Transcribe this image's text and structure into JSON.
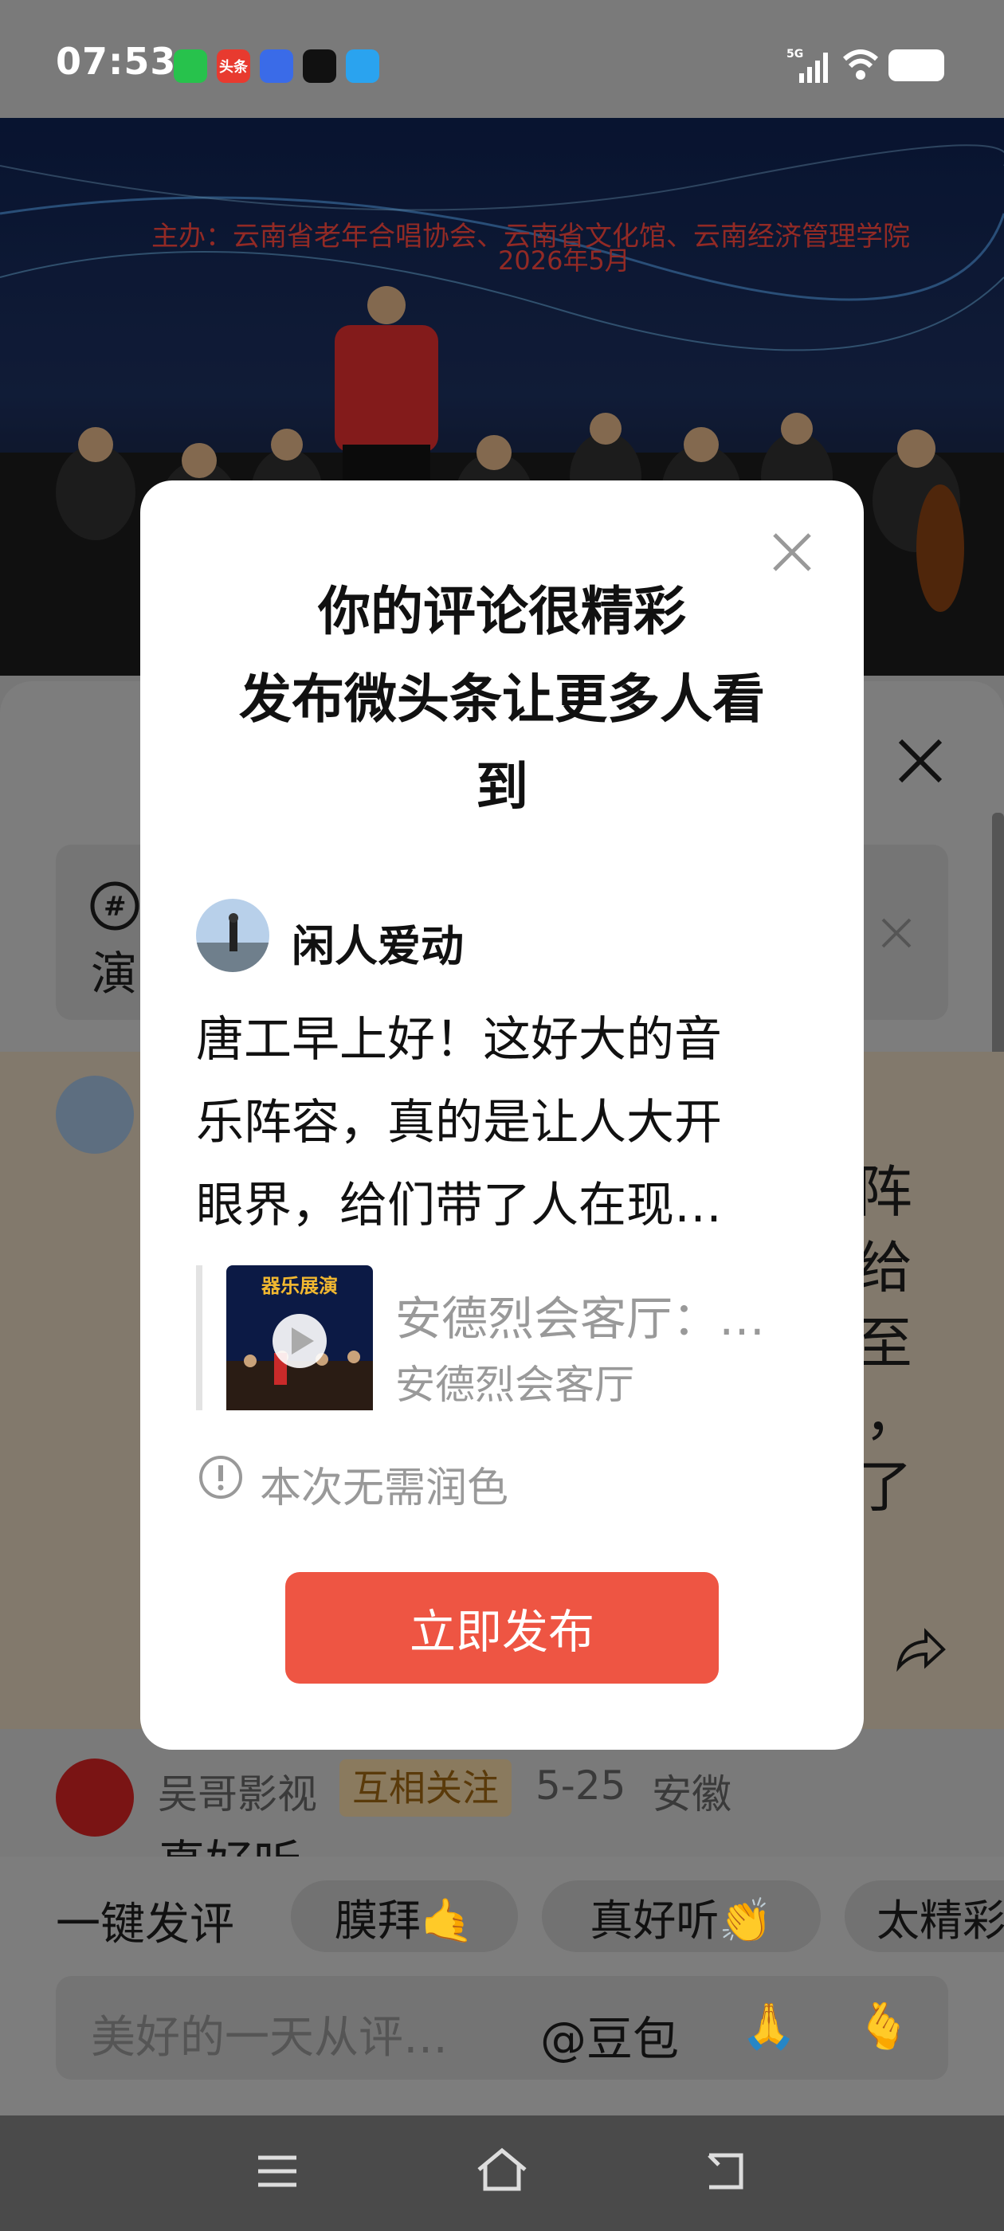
{
  "status_bar": {
    "time": "07:53",
    "apps": [
      "wechat-icon",
      "toutiao-icon",
      "baidu-icon",
      "tiktok-icon",
      "other-app-icon"
    ],
    "toutiao_label": "头条",
    "network": "5G"
  },
  "video": {
    "banner_line": "主办：云南省老年合唱协会、云南省文化馆、云南经济管理学院",
    "date": "2026年5月"
  },
  "background": {
    "topic_prefix": "演",
    "comment_fragments": [
      "阵",
      "给",
      "至",
      "，",
      "了"
    ],
    "reply_user": "吴哥影视",
    "reply_badge": "互相关注",
    "reply_date": "5-25",
    "reply_location": "安徽",
    "reply_text": "真好听"
  },
  "composer": {
    "quick_label": "一键发评",
    "chips": [
      "膜拜🤙",
      "真好听👏",
      "太精彩"
    ],
    "placeholder": "美好的一天从评…",
    "mention": "@豆包",
    "emojis": [
      "🙏",
      "🫰"
    ]
  },
  "modal": {
    "title_line1": "你的评论很精彩",
    "title_line2": "发布微头条让更多人看",
    "title_line3": "到",
    "username": "闲人爱动",
    "comment_line1": "唐工早上好！这好大的音",
    "comment_line2": "乐阵容，真的是让人大开",
    "comment_line3": "眼界，给们带了人在现…",
    "quote_thumb_text": "器乐展演",
    "quote_title": "安德烈会客厅：…",
    "quote_source": "安德烈会客厅",
    "notice": "本次无需润色",
    "publish_label": "立即发布"
  }
}
